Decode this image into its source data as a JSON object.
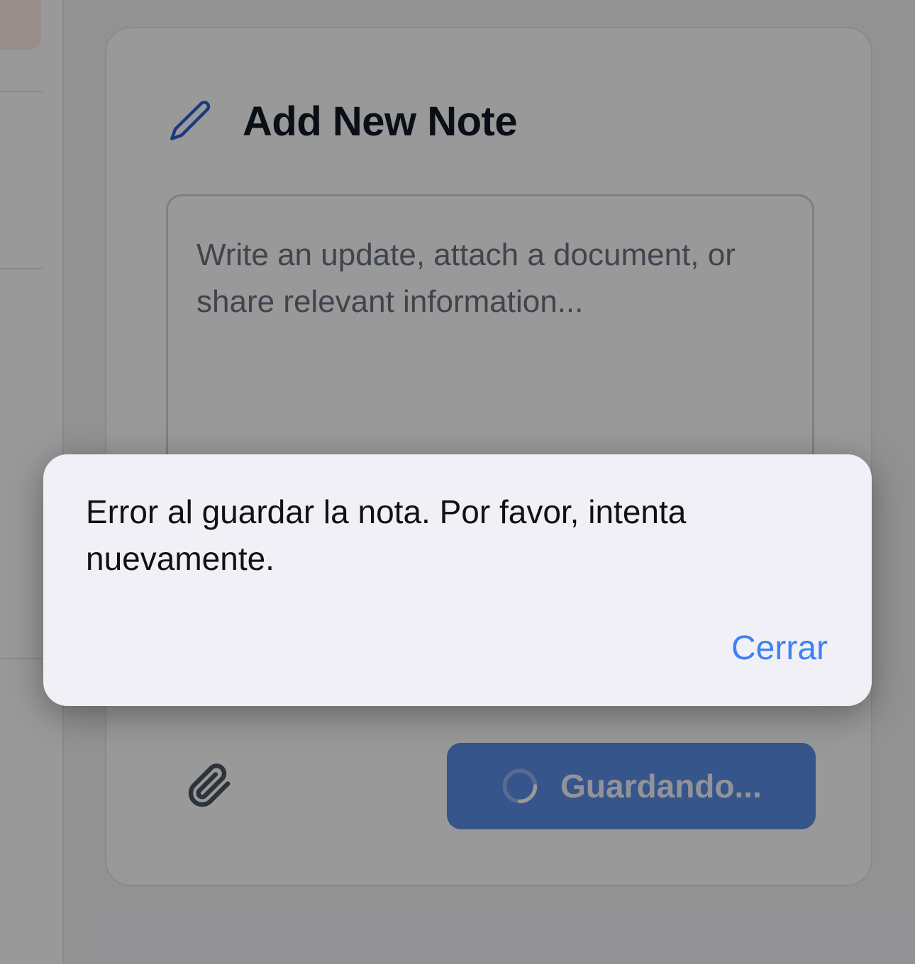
{
  "card": {
    "title": "Add New Note",
    "textarea_placeholder": "Write an update, attach a document, or share relevant information...",
    "save_button_label": "Guardando...",
    "icons": {
      "header": "pencil-icon",
      "attach": "paperclip-icon",
      "saving": "spinner-icon"
    }
  },
  "alert": {
    "message": "Error al guardar la nota. Por favor, intenta nuevamente.",
    "close_label": "Cerrar"
  },
  "colors": {
    "primary": "#3b82f6",
    "button": "#5b8ee6",
    "title": "#111827",
    "alert_bg": "#f1f0f6"
  }
}
